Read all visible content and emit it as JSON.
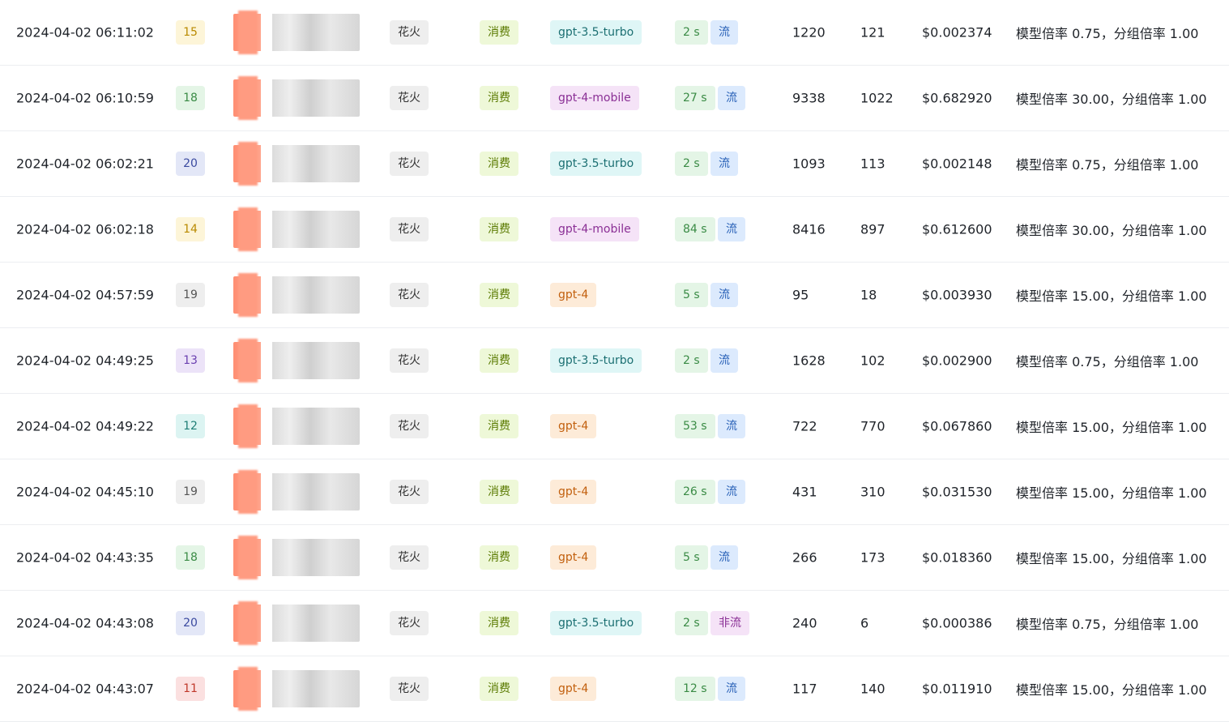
{
  "rows": [
    {
      "time": "2024-04-02 06:11:02",
      "user": "15",
      "user_color": "yellow",
      "channel": "花火",
      "type": "消费",
      "model": "gpt-3.5-turbo",
      "model_class": "gpt35",
      "duration": "2 s",
      "stream": "流",
      "stream_class": "stream",
      "prompt": "1220",
      "completion": "121",
      "cost": "$0.002374",
      "detail": "模型倍率 0.75，分组倍率 1.00"
    },
    {
      "time": "2024-04-02 06:10:59",
      "user": "18",
      "user_color": "green",
      "channel": "花火",
      "type": "消费",
      "model": "gpt-4-mobile",
      "model_class": "gpt4mobile",
      "duration": "27 s",
      "stream": "流",
      "stream_class": "stream",
      "prompt": "9338",
      "completion": "1022",
      "cost": "$0.682920",
      "detail": "模型倍率 30.00，分组倍率 1.00"
    },
    {
      "time": "2024-04-02 06:02:21",
      "user": "20",
      "user_color": "blue",
      "channel": "花火",
      "type": "消费",
      "model": "gpt-3.5-turbo",
      "model_class": "gpt35",
      "duration": "2 s",
      "stream": "流",
      "stream_class": "stream",
      "prompt": "1093",
      "completion": "113",
      "cost": "$0.002148",
      "detail": "模型倍率 0.75，分组倍率 1.00"
    },
    {
      "time": "2024-04-02 06:02:18",
      "user": "14",
      "user_color": "yellow",
      "channel": "花火",
      "type": "消费",
      "model": "gpt-4-mobile",
      "model_class": "gpt4mobile",
      "duration": "84 s",
      "stream": "流",
      "stream_class": "stream",
      "prompt": "8416",
      "completion": "897",
      "cost": "$0.612600",
      "detail": "模型倍率 30.00，分组倍率 1.00"
    },
    {
      "time": "2024-04-02 04:57:59",
      "user": "19",
      "user_color": "gray",
      "channel": "花火",
      "type": "消费",
      "model": "gpt-4",
      "model_class": "gpt4",
      "duration": "5 s",
      "stream": "流",
      "stream_class": "stream",
      "prompt": "95",
      "completion": "18",
      "cost": "$0.003930",
      "detail": "模型倍率 15.00，分组倍率 1.00"
    },
    {
      "time": "2024-04-02 04:49:25",
      "user": "13",
      "user_color": "purple",
      "channel": "花火",
      "type": "消费",
      "model": "gpt-3.5-turbo",
      "model_class": "gpt35",
      "duration": "2 s",
      "stream": "流",
      "stream_class": "stream",
      "prompt": "1628",
      "completion": "102",
      "cost": "$0.002900",
      "detail": "模型倍率 0.75，分组倍率 1.00"
    },
    {
      "time": "2024-04-02 04:49:22",
      "user": "12",
      "user_color": "teal",
      "channel": "花火",
      "type": "消费",
      "model": "gpt-4",
      "model_class": "gpt4",
      "duration": "53 s",
      "stream": "流",
      "stream_class": "stream",
      "prompt": "722",
      "completion": "770",
      "cost": "$0.067860",
      "detail": "模型倍率 15.00，分组倍率 1.00"
    },
    {
      "time": "2024-04-02 04:45:10",
      "user": "19",
      "user_color": "gray",
      "channel": "花火",
      "type": "消费",
      "model": "gpt-4",
      "model_class": "gpt4",
      "duration": "26 s",
      "stream": "流",
      "stream_class": "stream",
      "prompt": "431",
      "completion": "310",
      "cost": "$0.031530",
      "detail": "模型倍率 15.00，分组倍率 1.00"
    },
    {
      "time": "2024-04-02 04:43:35",
      "user": "18",
      "user_color": "green",
      "channel": "花火",
      "type": "消费",
      "model": "gpt-4",
      "model_class": "gpt4",
      "duration": "5 s",
      "stream": "流",
      "stream_class": "stream",
      "prompt": "266",
      "completion": "173",
      "cost": "$0.018360",
      "detail": "模型倍率 15.00，分组倍率 1.00"
    },
    {
      "time": "2024-04-02 04:43:08",
      "user": "20",
      "user_color": "blue",
      "channel": "花火",
      "type": "消费",
      "model": "gpt-3.5-turbo",
      "model_class": "gpt35",
      "duration": "2 s",
      "stream": "非流",
      "stream_class": "nonstream",
      "prompt": "240",
      "completion": "6",
      "cost": "$0.000386",
      "detail": "模型倍率 0.75，分组倍率 1.00"
    },
    {
      "time": "2024-04-02 04:43:07",
      "user": "11",
      "user_color": "red",
      "channel": "花火",
      "type": "消费",
      "model": "gpt-4",
      "model_class": "gpt4",
      "duration": "12 s",
      "stream": "流",
      "stream_class": "stream",
      "prompt": "117",
      "completion": "140",
      "cost": "$0.011910",
      "detail": "模型倍率 15.00，分组倍率 1.00"
    }
  ]
}
